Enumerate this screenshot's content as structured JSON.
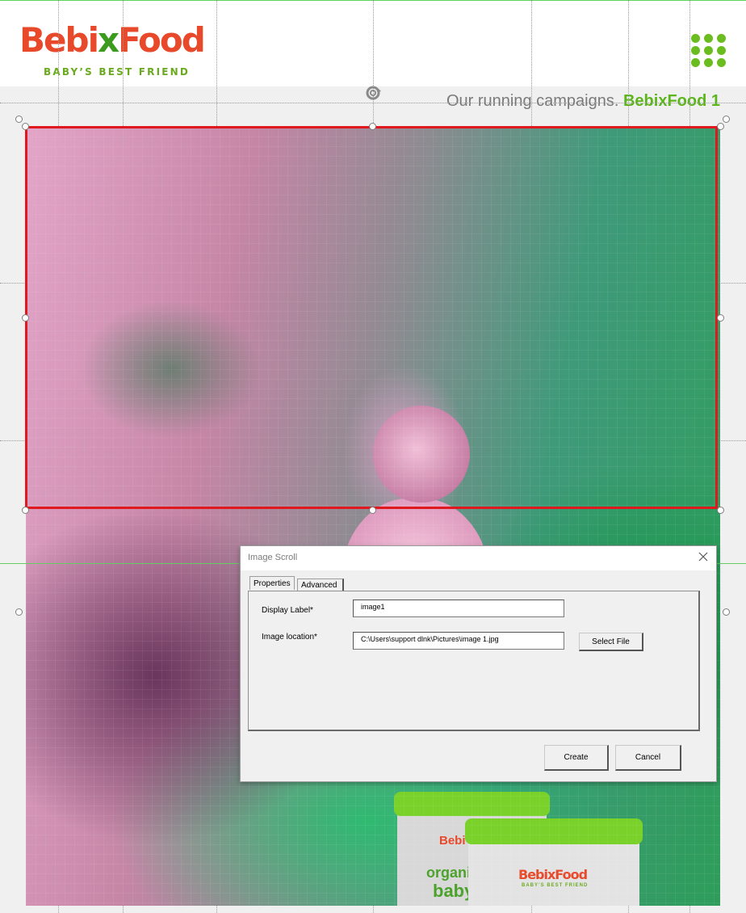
{
  "header": {
    "logo_part1": "Bebi",
    "logo_part2": "x",
    "logo_part3": "Food",
    "logo_tagline": "BABY’S BEST FRIEND",
    "menu_icon": "grid-dots-icon"
  },
  "slide": {
    "caption_prefix": "Our running campaigns.",
    "caption_brand": "BebixFood 1",
    "image": "baby-photo",
    "jar_brand": "BebixFood",
    "jar_tagline": "BABY’S BEST FRIEND",
    "jar_back_text1": "organic",
    "jar_back_text2": "baby",
    "jar_back_brand": "Bebi"
  },
  "dialog": {
    "title": "Image Scroll",
    "tabs": [
      {
        "label": "Properties",
        "active": true
      },
      {
        "label": "Advanced",
        "active": false
      }
    ],
    "fields": {
      "display_label": {
        "label": "Display Label*",
        "value": "image1"
      },
      "image_location": {
        "label": "Image location*",
        "value": "C:\\Users\\support dlnk\\Pictures\\image 1.jpg"
      }
    },
    "select_file_label": "Select File",
    "create_label": "Create",
    "cancel_label": "Cancel"
  },
  "colors": {
    "brand_red": "#e8492b",
    "brand_green": "#3c9b1f",
    "accent_green": "#5cb51d",
    "selection_red": "#e0191f"
  }
}
